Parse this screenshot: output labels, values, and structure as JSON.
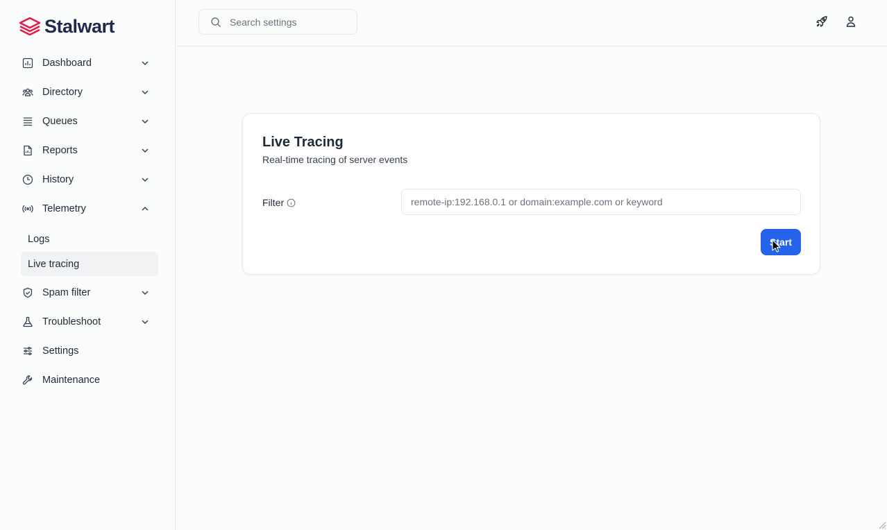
{
  "brand": {
    "name": "Stalwart",
    "accent": "#e11d48"
  },
  "search": {
    "placeholder": "Search settings"
  },
  "sidebar": {
    "items": [
      {
        "label": "Dashboard",
        "icon": "bar-chart-icon",
        "expandable": true
      },
      {
        "label": "Directory",
        "icon": "users-icon",
        "expandable": true
      },
      {
        "label": "Queues",
        "icon": "queue-list-icon",
        "expandable": true
      },
      {
        "label": "Reports",
        "icon": "document-icon",
        "expandable": true
      },
      {
        "label": "History",
        "icon": "clock-icon",
        "expandable": true
      },
      {
        "label": "Telemetry",
        "icon": "signal-icon",
        "expandable": true,
        "expanded": true,
        "children": [
          {
            "label": "Logs"
          },
          {
            "label": "Live tracing",
            "active": true
          }
        ]
      },
      {
        "label": "Spam filter",
        "icon": "shield-check-icon",
        "expandable": true
      },
      {
        "label": "Troubleshoot",
        "icon": "flask-icon",
        "expandable": true
      },
      {
        "label": "Settings",
        "icon": "sliders-icon",
        "expandable": false
      },
      {
        "label": "Maintenance",
        "icon": "wrench-icon",
        "expandable": false
      }
    ]
  },
  "topbar": {
    "icons": [
      "rocket-icon",
      "user-icon"
    ]
  },
  "card": {
    "title": "Live Tracing",
    "subtitle": "Real-time tracing of server events",
    "filter_label": "Filter",
    "filter_placeholder": "remote-ip:192.168.0.1 or domain:example.com or keyword",
    "start_label": "Start",
    "primary_color": "#2563eb"
  }
}
